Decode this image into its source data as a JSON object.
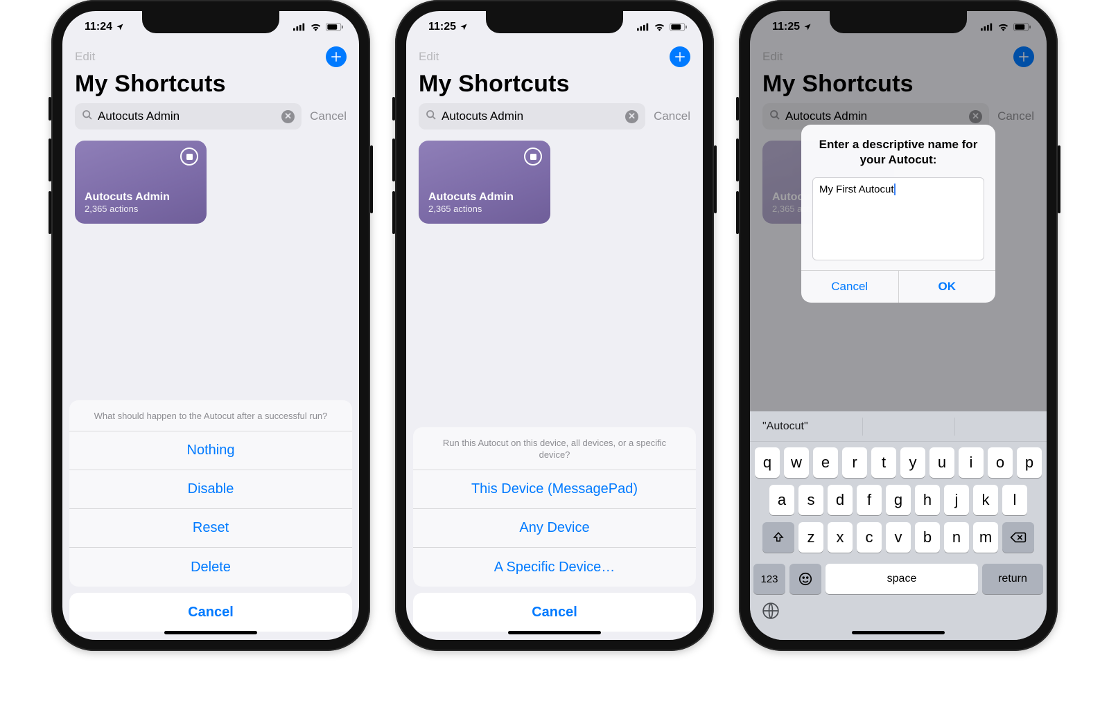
{
  "phones": [
    {
      "time": "11:24"
    },
    {
      "time": "11:25"
    },
    {
      "time": "11:25"
    }
  ],
  "nav": {
    "edit": "Edit",
    "title": "My Shortcuts"
  },
  "search": {
    "value": "Autocuts Admin",
    "cancel": "Cancel"
  },
  "card": {
    "title": "Autocuts Admin",
    "subtitle": "2,365 actions"
  },
  "sheet1": {
    "header": "What should happen to the Autocut after a successful run?",
    "items": [
      "Nothing",
      "Disable",
      "Reset",
      "Delete"
    ],
    "cancel": "Cancel"
  },
  "sheet2": {
    "header": "Run this Autocut on this device, all devices, or a specific device?",
    "items": [
      "This Device (MessagePad)",
      "Any Device",
      "A Specific Device…"
    ],
    "cancel": "Cancel"
  },
  "alert": {
    "title": "Enter a descriptive name for your Autocut:",
    "input": "My First Autocut",
    "cancel": "Cancel",
    "ok": "OK"
  },
  "keyboard": {
    "suggestion": "\"Autocut\"",
    "row1": [
      "q",
      "w",
      "e",
      "r",
      "t",
      "y",
      "u",
      "i",
      "o",
      "p"
    ],
    "row2": [
      "a",
      "s",
      "d",
      "f",
      "g",
      "h",
      "j",
      "k",
      "l"
    ],
    "row3": [
      "z",
      "x",
      "c",
      "v",
      "b",
      "n",
      "m"
    ],
    "mode": "123",
    "space": "space",
    "return": "return"
  }
}
